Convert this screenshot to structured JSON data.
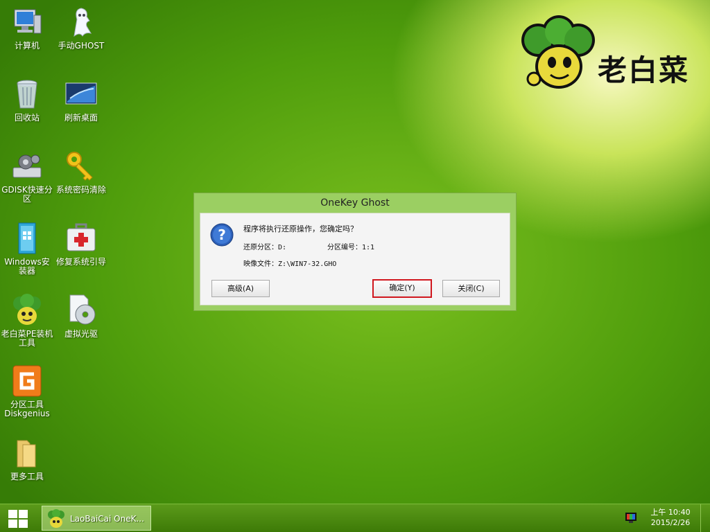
{
  "desktop": {
    "icons": [
      {
        "label1": "计算机",
        "label2": ""
      },
      {
        "label1": "手动GHOST",
        "label2": ""
      },
      {
        "label1": "回收站",
        "label2": ""
      },
      {
        "label1": "刷新桌面",
        "label2": ""
      },
      {
        "label1": "GDISK快速分",
        "label2": "区"
      },
      {
        "label1": "系统密码清除",
        "label2": ""
      },
      {
        "label1": "Windows安",
        "label2": "装器"
      },
      {
        "label1": "修复系统引导",
        "label2": ""
      },
      {
        "label1": "老白菜PE装机",
        "label2": "工具"
      },
      {
        "label1": "虚拟光驱",
        "label2": ""
      },
      {
        "label1": "分区工具",
        "label2": "Diskgenius"
      },
      {
        "label1": "更多工具",
        "label2": ""
      }
    ]
  },
  "logo": {
    "text": "老白菜"
  },
  "dialog": {
    "title": "OneKey Ghost",
    "question": "程序将执行还原操作，您确定吗？",
    "restore_partition_label": "还原分区：D:",
    "partition_number_label": "分区编号：1:1",
    "image_file_label": "映像文件：Z:\\WIN7-32.GHO",
    "advanced_button": "高级(A)",
    "confirm_button": "确定(Y)",
    "close_button": "关闭(C)"
  },
  "taskbar": {
    "task_label": "LaoBaiCai OneK...",
    "time": "上午 10:40",
    "date": "2015/2/26"
  },
  "colors": {
    "focus_border": "#d0161d",
    "dialog_frame": "#9bcf62"
  }
}
